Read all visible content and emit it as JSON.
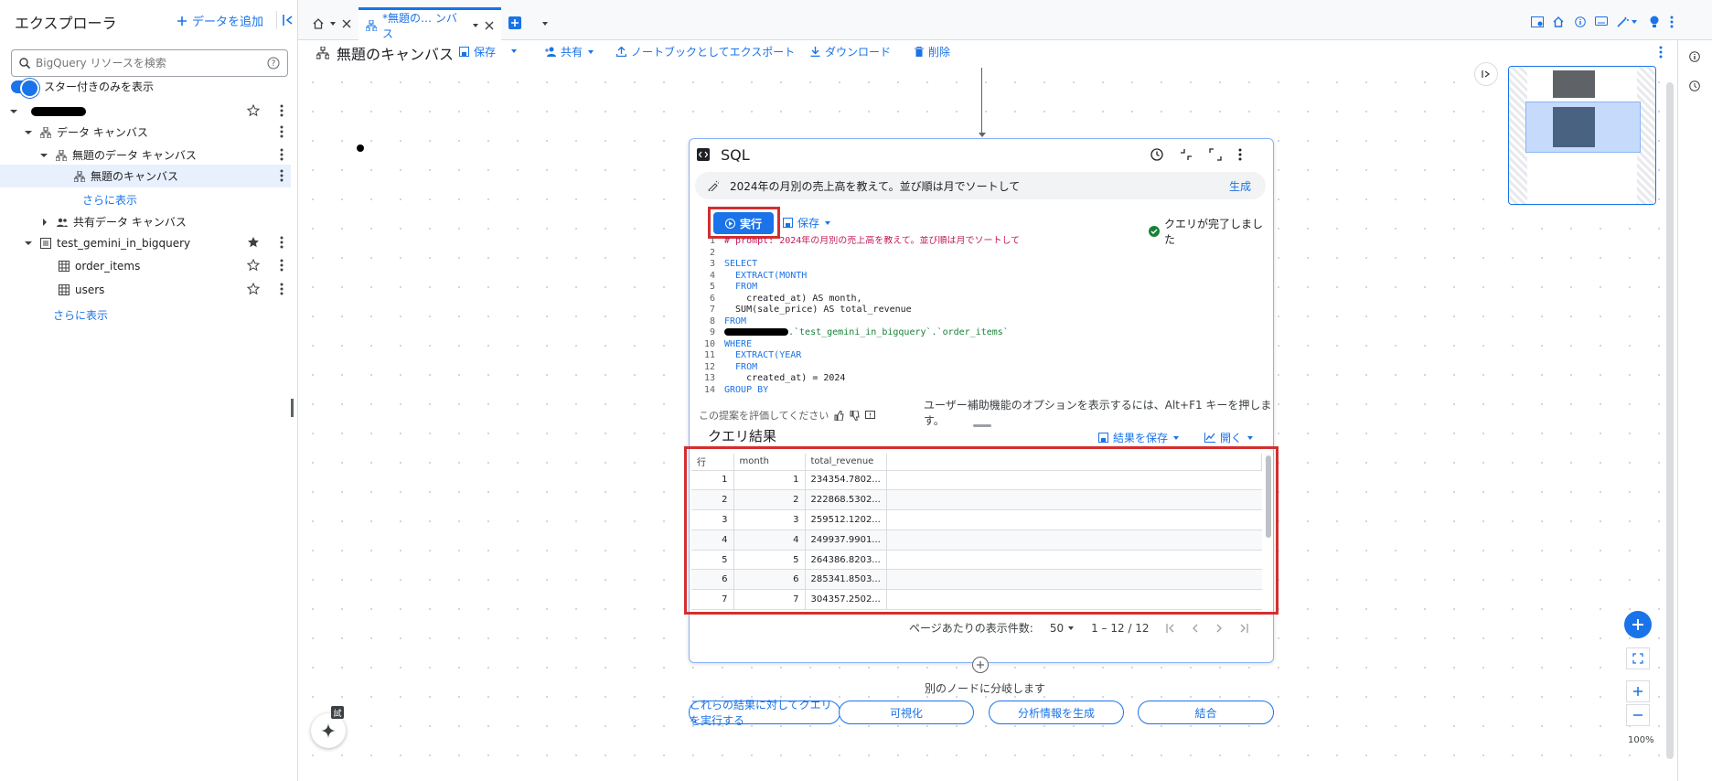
{
  "explorer": {
    "title": "エクスプローラ",
    "add_data": "データを追加",
    "search_placeholder": "BigQuery リソースを検索",
    "starred_only": "スター付きのみを表示",
    "tree": {
      "data_canvas": "データ キャンバス",
      "untitled_data_canvas": "無題のデータ キャンバス",
      "untitled_canvas": "無題のキャンバス",
      "show_more_1": "さらに表示",
      "shared_data_canvas": "共有データ キャンバス",
      "dataset": "test_gemini_in_bigquery",
      "table_1": "order_items",
      "table_2": "users",
      "show_more_2": "さらに表示"
    }
  },
  "tabs": {
    "active_label": "*無題の… ンバス"
  },
  "toolbar": {
    "canvas_title": "無題のキャンバス",
    "save": "保存",
    "share": "共有",
    "export_notebook": "ノートブックとしてエクスポート",
    "download": "ダウンロード",
    "delete": "削除"
  },
  "sql_node": {
    "title": "SQL",
    "prompt": "2024年の月別の売上高を教えて。並び順は月でソートして",
    "generate": "生成",
    "run": "実行",
    "save": "保存",
    "query_status": "クエリが完了しました",
    "code_lines": [
      {
        "no": "1",
        "text": "# prompt: 2024年の月別の売上高を教えて。並び順は月でソートして"
      },
      {
        "no": "2",
        "text": ""
      },
      {
        "no": "3",
        "text": "SELECT"
      },
      {
        "no": "4",
        "text": "  EXTRACT(MONTH"
      },
      {
        "no": "5",
        "text": "  FROM"
      },
      {
        "no": "6",
        "text": "    created_at) AS month,"
      },
      {
        "no": "7",
        "text": "  SUM(sale_price) AS total_revenue"
      },
      {
        "no": "8",
        "text": "FROM"
      },
      {
        "no": "9",
        "text": ".`test_gemini_in_bigquery`.`order_items`"
      },
      {
        "no": "10",
        "text": "WHERE"
      },
      {
        "no": "11",
        "text": "  EXTRACT(YEAR"
      },
      {
        "no": "12",
        "text": "  FROM"
      },
      {
        "no": "13",
        "text": "    created_at) = 2024"
      },
      {
        "no": "14",
        "text": "GROUP BY"
      }
    ],
    "a11y_hint": "ユーザー補助機能のオプションを表示するには、Alt+F1 キーを押します。",
    "feedback": "この提案を評価してください",
    "results_title": "クエリ結果",
    "save_results": "結果を保存",
    "open": "開く",
    "columns": [
      "行",
      "month",
      "total_revenue"
    ],
    "rows": [
      [
        "1",
        "1",
        "234354.7802..."
      ],
      [
        "2",
        "2",
        "222868.5302..."
      ],
      [
        "3",
        "3",
        "259512.1202..."
      ],
      [
        "4",
        "4",
        "249937.9901..."
      ],
      [
        "5",
        "5",
        "264386.8203..."
      ],
      [
        "6",
        "6",
        "285341.8503..."
      ],
      [
        "7",
        "7",
        "304357.2502..."
      ]
    ],
    "page_size_label": "ページあたりの表示件数:",
    "page_size": "50",
    "page_range": "1 – 12 / 12"
  },
  "branch": {
    "label": "別のノードに分岐します",
    "query_results": "これらの結果に対してクエリを実行する",
    "visualize": "可視化",
    "insights": "分析情報を生成",
    "join": "結合"
  },
  "zoom": {
    "level": "100%"
  },
  "badge": "試",
  "colors": {
    "accent": "#1a73e8",
    "highlight": "#d32f2f",
    "success": "#188038"
  }
}
